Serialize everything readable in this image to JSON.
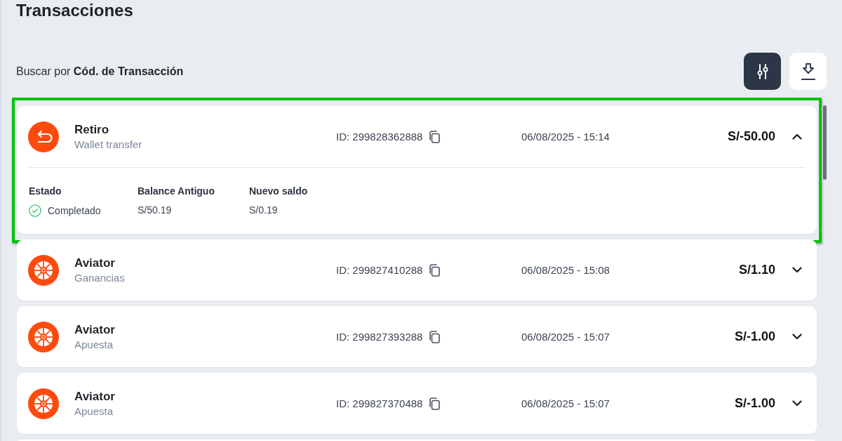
{
  "page": {
    "title": "Transacciones"
  },
  "search": {
    "label": "Buscar por **Cód. de Transacción**"
  },
  "actions": [
    {
      "kind": "filter"
    },
    {
      "kind": "download"
    }
  ],
  "transactions": [
    {
      "kind": "withdrawal",
      "title": "Retiro",
      "subtitle": "Wallet transfer",
      "id": "ID: 299828362888",
      "date": "06/08/2025 - 15:14",
      "amount": "S/-50.00",
      "expanded": true,
      "highlighted": true,
      "details": [
        {
          "kind": "status",
          "label": "Estado",
          "value": "Completado"
        },
        {
          "kind": "amount",
          "label": "Balance Antiguo",
          "value": "S/50.19"
        },
        {
          "kind": "amount",
          "label": "Nuevo saldo",
          "value": "S/0.19"
        }
      ]
    },
    {
      "kind": "game",
      "title": "Aviator",
      "subtitle": "Ganancias",
      "id": "ID: 299827410288",
      "date": "06/08/2025 - 15:08",
      "amount": "S/1.10",
      "expanded": false,
      "highlighted": false
    },
    {
      "kind": "game",
      "title": "Aviator",
      "subtitle": "Apuesta",
      "id": "ID: 299827393288",
      "date": "06/08/2025 - 15:07",
      "amount": "S/-1.00",
      "expanded": false,
      "highlighted": false
    },
    {
      "kind": "game",
      "title": "Aviator",
      "subtitle": "Apuesta",
      "id": "ID: 299827370488",
      "date": "06/08/2025 - 15:07",
      "amount": "S/-1.00",
      "expanded": false,
      "highlighted": false
    }
  ]
}
